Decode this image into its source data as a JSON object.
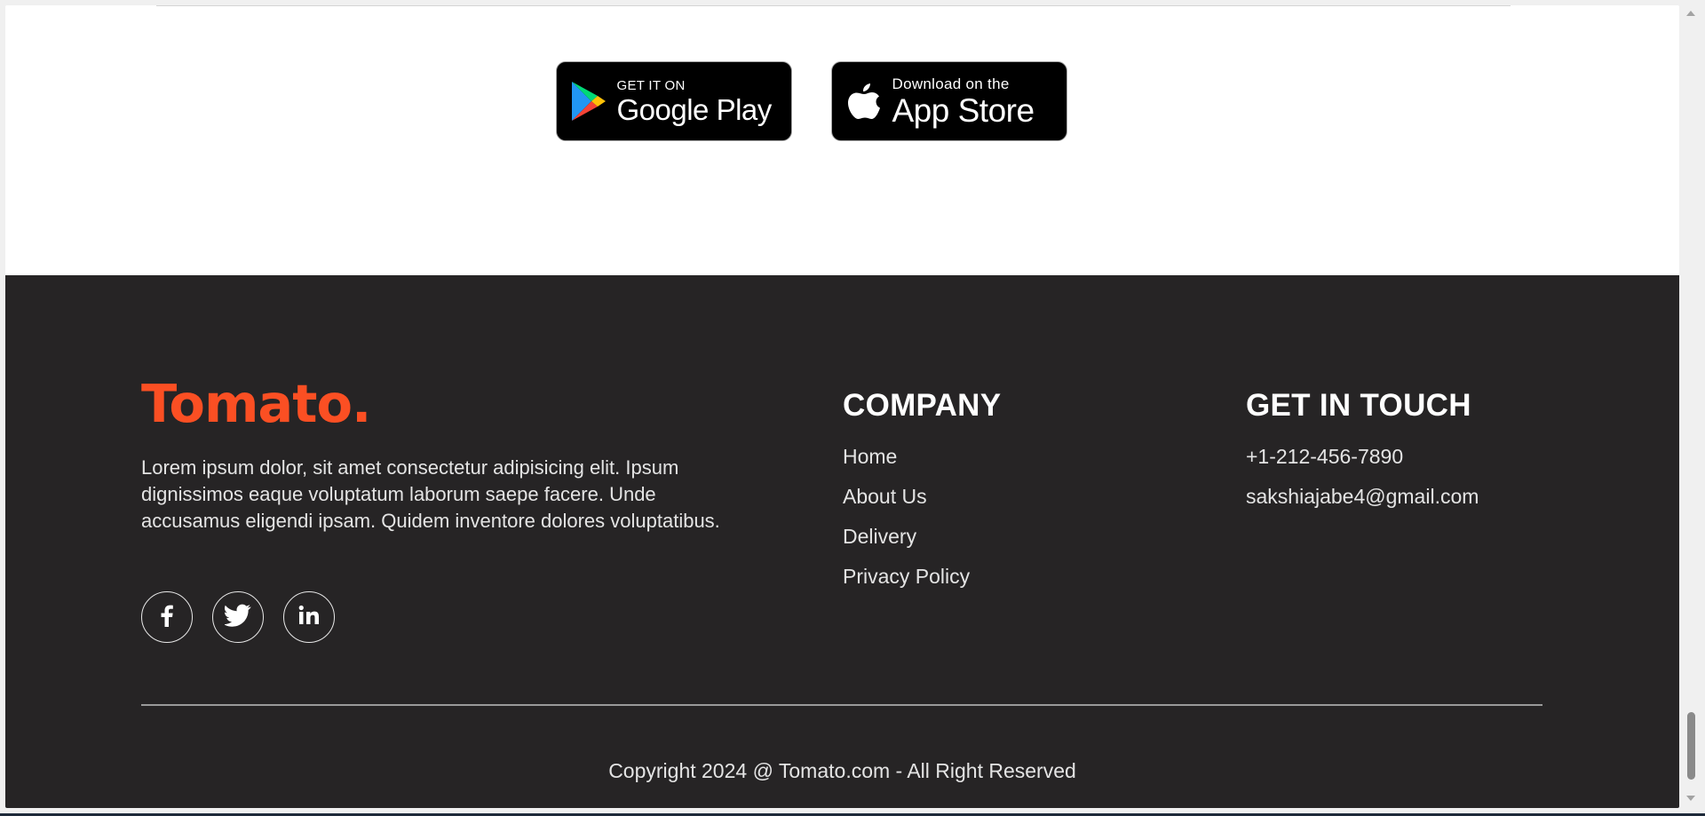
{
  "stores": {
    "google": {
      "small": "GET IT ON",
      "big": "Google Play"
    },
    "apple": {
      "small": "Download on the",
      "big": "App Store"
    }
  },
  "footer": {
    "brand": "Tomato.",
    "description": "Lorem ipsum dolor, sit amet consectetur adipisicing elit. Ipsum dignissimos eaque voluptatum laborum saepe facere. Unde accusamus eligendi ipsam. Quidem inventore dolores voluptatibus.",
    "socials": [
      {
        "name": "facebook-icon"
      },
      {
        "name": "twitter-icon"
      },
      {
        "name": "linkedin-icon"
      }
    ],
    "company": {
      "title": "COMPANY",
      "items": [
        "Home",
        "About Us",
        "Delivery",
        "Privacy Policy"
      ]
    },
    "contact": {
      "title": "GET IN TOUCH",
      "phone": "+1-212-456-7890",
      "email": "sakshiajabe4@gmail.com"
    },
    "copyright": "Copyright 2024 @ Tomato.com - All Right Reserved"
  },
  "colors": {
    "brand": "#fb4f23",
    "footer_bg": "#262425"
  }
}
